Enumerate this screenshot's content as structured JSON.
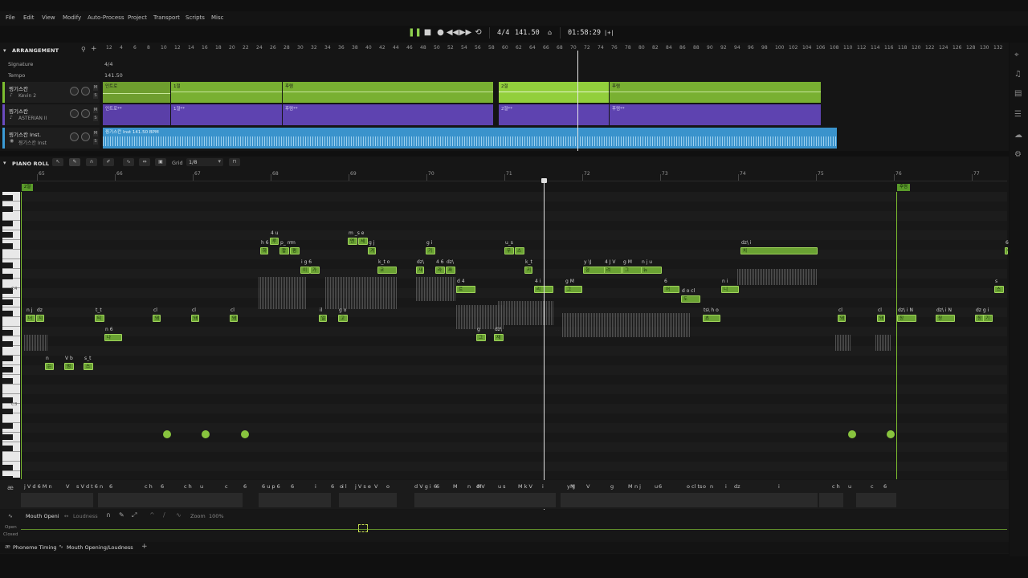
{
  "menu": [
    "File",
    "Edit",
    "View",
    "Modify",
    "Auto-Process",
    "Project",
    "Transport",
    "Scripts",
    "Misc"
  ],
  "transport": {
    "time_signature": "4/4",
    "tempo": "141.50",
    "position": "01:58:29",
    "snap_label": "|+|"
  },
  "arrangement": {
    "title": "ARRANGEMENT",
    "ruler_bars": [
      "12",
      "4",
      "6",
      "8",
      "10",
      "12",
      "14",
      "16",
      "18",
      "20",
      "22",
      "24",
      "26",
      "28",
      "30",
      "32",
      "34",
      "36",
      "38",
      "40",
      "42",
      "44",
      "46",
      "48",
      "50",
      "52",
      "54",
      "56",
      "58",
      "60",
      "62",
      "64",
      "66",
      "68",
      "70",
      "72",
      "74",
      "76",
      "78",
      "80",
      "82",
      "84",
      "86",
      "88",
      "90",
      "92",
      "94",
      "96",
      "98",
      "100",
      "102",
      "104",
      "106",
      "108",
      "110",
      "112",
      "114",
      "116",
      "118",
      "120",
      "122",
      "124",
      "126",
      "128",
      "130",
      "132"
    ],
    "signature_label": "Signature",
    "signature_value": "4/4",
    "tempo_label": "Tempo",
    "tempo_value": "141.50",
    "tracks": [
      {
        "name": "찡기스칸",
        "singer": "Kevin 2",
        "color": "#7cbd2f",
        "clips": [
          {
            "label": "인트로"
          },
          {
            "label": "1절"
          },
          {
            "label": "후렴"
          },
          {
            "label": "2절"
          },
          {
            "label": "후렴"
          }
        ]
      },
      {
        "name": "찡기스칸",
        "singer": "ASTERIAN II",
        "color": "#6a4bc0",
        "clips": [
          {
            "label": "인트로**"
          },
          {
            "label": "1절**"
          },
          {
            "label": "후렴**"
          },
          {
            "label": "2절**"
          },
          {
            "label": "후렴**"
          }
        ]
      },
      {
        "name": "찡기스칸 Inst.",
        "singer": "찡기스칸 Inst",
        "color": "#3b9bd6",
        "clips": [
          {
            "label": "찡기스칸 Inst    141.50 BPM"
          }
        ]
      }
    ]
  },
  "piano_roll": {
    "title": "PIANO ROLL",
    "grid_label": "Grid",
    "grid_value": "1/8",
    "section_start": "2절",
    "section_end": "후렴",
    "key_c4": "C4",
    "key_c3": "C3",
    "ruler_bars": [
      "65",
      "66",
      "67",
      "68",
      "69",
      "70",
      "71",
      "72",
      "73",
      "74",
      "75",
      "76",
      "77"
    ],
    "notes": [
      {
        "ph": "n j",
        "ly": "너"
      },
      {
        "ph": "dz",
        "ly": "지"
      },
      {
        "ph": "n",
        "ly": "는"
      },
      {
        "ph": "V b",
        "ly": "멈"
      },
      {
        "ph": "s_t",
        "ly": "스"
      },
      {
        "ph": "t_t",
        "ly": "티"
      },
      {
        "ph": "n 6",
        "ly": "나"
      },
      {
        "ph": "cl",
        "ly": "돼"
      },
      {
        "ph": "cl",
        "ly": "돼"
      },
      {
        "ph": "cl",
        "ly": "돼"
      },
      {
        "ph": "h 6",
        "ly": "하"
      },
      {
        "ph": "4 u",
        "ly": "루"
      },
      {
        "ph": "p_ m",
        "ly": "팝"
      },
      {
        "ph": "m",
        "ly": "펌"
      },
      {
        "ph": "i g 6",
        "ly": "이"
      },
      {
        "ph": "",
        "ly": "가"
      },
      {
        "ph": "il",
        "ly": "일"
      },
      {
        "ph": "g o",
        "ly": "고"
      },
      {
        "ph": "m _s e",
        "ly": "멘"
      },
      {
        "ph": "",
        "ly": "세"
      },
      {
        "ph": "g j",
        "ly": "겨"
      },
      {
        "ph": "k_t o",
        "ly": "코"
      },
      {
        "ph": "dz\\",
        "ly": "재"
      },
      {
        "ph": "g i",
        "ly": "기"
      },
      {
        "ph": "4 6",
        "ly": "라"
      },
      {
        "ph": "dz\\",
        "ly": "짜"
      },
      {
        "ph": "d 4",
        "ly": "드"
      },
      {
        "ph": "",
        "ly": "르"
      },
      {
        "ph": "g",
        "ly": "그"
      },
      {
        "ph": "dz\\",
        "ly": "재"
      },
      {
        "ph": "u_s",
        "ly": "우"
      },
      {
        "ph": "",
        "ly": "스"
      },
      {
        "ph": "k_t",
        "ly": "키"
      },
      {
        "ph": "4 i",
        "ly": "리"
      },
      {
        "ph": "g M",
        "ly": "그"
      },
      {
        "ph": "y \\J",
        "ly": "형"
      },
      {
        "ph": "4 J V",
        "ly": "려"
      },
      {
        "ph": "g M",
        "ly": "그"
      },
      {
        "ph": "n j u",
        "ly": "뉴"
      },
      {
        "ph": "6",
        "ly": "어"
      },
      {
        "ph": "d o cl",
        "ly": "도"
      },
      {
        "ph": "ts\\ h o",
        "ly": "쵸"
      },
      {
        "ph": "n i",
        "ly": "니"
      },
      {
        "ph": "dz\\ i",
        "ly": "치"
      },
      {
        "ph": "cl",
        "ly": "돼"
      },
      {
        "ph": "cl",
        "ly": "돼"
      },
      {
        "ph": "dz\\ i N",
        "ly": "징"
      },
      {
        "ph": "dz\\ i N",
        "ly": "징"
      },
      {
        "ph": "dz g i",
        "ly": "징"
      },
      {
        "ph": "",
        "ly": "기"
      },
      {
        "ph": "s",
        "ly": "스"
      },
      {
        "ph": "6",
        "ly": "아"
      }
    ]
  },
  "phoneme_lane": {
    "phonemes": [
      "j V d 6 M n",
      "V",
      "s V d t 6 n",
      "6",
      "c h",
      "6",
      "c h",
      "u",
      "c",
      "6",
      "6 u p 6",
      "6",
      "i",
      "6",
      "i l",
      "o",
      "j V s e",
      "V",
      "o",
      "d V g i",
      "6",
      "6",
      "M",
      "n",
      "M",
      "d V",
      "u s",
      "M k V",
      "i",
      "M",
      "y \\J",
      "V",
      "g",
      "M",
      "n j",
      "u",
      "6",
      "o cl ts",
      "o",
      "n",
      "i",
      "dz",
      "i",
      "c h",
      "u",
      "c",
      "6"
    ]
  },
  "param_lane": {
    "name": "Mouth Openi",
    "secondary": "Loudness",
    "zoom_label": "Zoom",
    "zoom_value": "100%",
    "open_label": "Open",
    "closed_label": "Closed"
  },
  "bottom_tabs": [
    "Phoneme Timing",
    "Mouth Opening/Loudness"
  ]
}
